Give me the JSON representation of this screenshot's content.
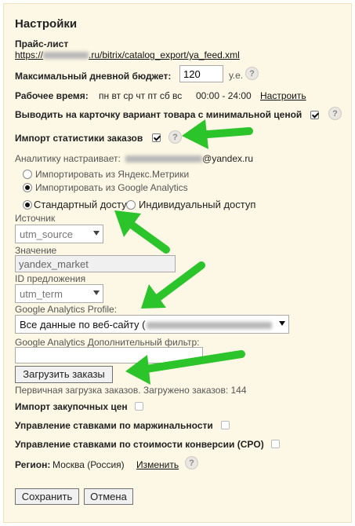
{
  "title": "Настройки",
  "price_list": {
    "label": "Прайс-лист",
    "url_prefix": "https://",
    "url_suffix": ".ru/bitrix/catalog_export/ya_feed.xml"
  },
  "budget": {
    "label": "Максимальный дневной бюджет:",
    "value": "120",
    "unit": "у.е."
  },
  "work_time": {
    "label": "Рабочее время:",
    "days": "пн вт ср чт пт сб вс",
    "hours": "00:00 - 24:00",
    "configure_link": "Настроить"
  },
  "min_price_card": {
    "label": "Выводить на карточку вариант товара с минимальной ценой",
    "checked": true
  },
  "import_stats": {
    "label": "Импорт статистики заказов",
    "checked": true
  },
  "analytics_by": {
    "label": "Аналитику настраивает:",
    "email_suffix": "@yandex.ru"
  },
  "import_source": {
    "options": [
      "Импортировать из Яндекс.Метрики",
      "Импортировать из Google Analytics"
    ],
    "selected": 1
  },
  "access": {
    "options": [
      "Стандартный доступ",
      "Индивидуальный доступ"
    ],
    "selected": 0
  },
  "source": {
    "label": "Источник",
    "value": "utm_source"
  },
  "value_field": {
    "label": "Значение",
    "value": "yandex_market"
  },
  "offer_id": {
    "label": "ID предложения",
    "value": "utm_term"
  },
  "ga_profile": {
    "label": "Google Analytics Profile:",
    "value": "Все данные по веб-сайту ("
  },
  "ga_filter": {
    "label": "Google Analytics Дополнительный фильтр:",
    "value": ""
  },
  "load_orders": {
    "button": "Загрузить заказы",
    "status": "Первичная загрузка заказов. Загружено заказов: 144"
  },
  "purchase_import": {
    "label": "Импорт закупочных цен",
    "checked": false
  },
  "margin_bids": {
    "label": "Управление ставками по маржинальности",
    "checked": false
  },
  "cpo_bids": {
    "label": "Управление ставками по стоимости конверсии (CPO)",
    "checked": false
  },
  "region": {
    "label": "Регион:",
    "value": "Москва (Россия)",
    "change_link": "Изменить"
  },
  "help_glyph": "?",
  "actions": {
    "save": "Сохранить",
    "cancel": "Отмена"
  },
  "colors": {
    "panel_bg": "#fdf8e5",
    "arrow": "#2bc42b"
  }
}
